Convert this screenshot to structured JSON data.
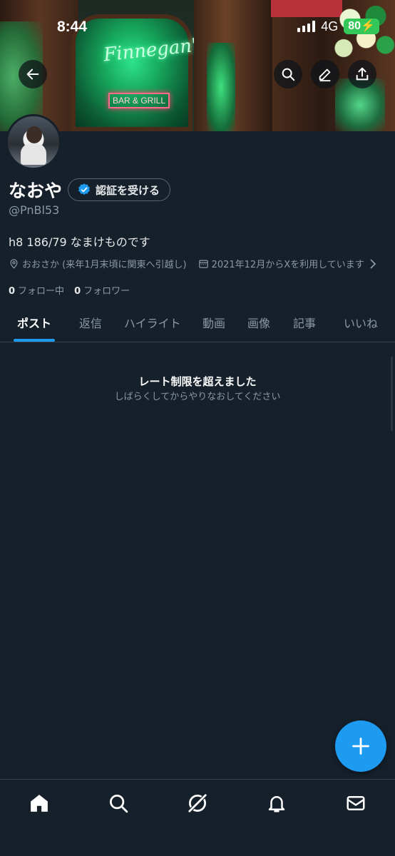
{
  "status_bar": {
    "time": "8:44",
    "network": "4G",
    "battery": "80"
  },
  "banner": {
    "neon_text": "Finnegan's",
    "neon_sign": "BAR & GRILL"
  },
  "header_icons": [
    "back-arrow-icon",
    "search-icon",
    "edit-icon",
    "share-icon"
  ],
  "profile": {
    "name": "なおや",
    "verify_button": "認証を受ける",
    "handle": "@PnBl53",
    "bio": "h8 186/79 なまけものです",
    "location": "おおさか (来年1月末頃に関東へ引越し)",
    "joined": "2021年12月からXを利用しています",
    "following_count": "0",
    "following_label": "フォロー中",
    "followers_count": "0",
    "followers_label": "フォロワー"
  },
  "tabs": [
    "ポスト",
    "返信",
    "ハイライト",
    "動画",
    "画像",
    "記事",
    "いいね"
  ],
  "active_tab": "ポスト",
  "message": {
    "title": "レート制限を超えました",
    "subtitle": "しばらくしてからやりなおしてください"
  },
  "bottom_nav": [
    "home-icon",
    "search-icon",
    "grok-icon",
    "notifications-icon",
    "messages-icon"
  ],
  "colors": {
    "background": "#15202b",
    "accent": "#1d9bf0",
    "muted_text": "#8b98a5",
    "battery": "#34c759"
  }
}
